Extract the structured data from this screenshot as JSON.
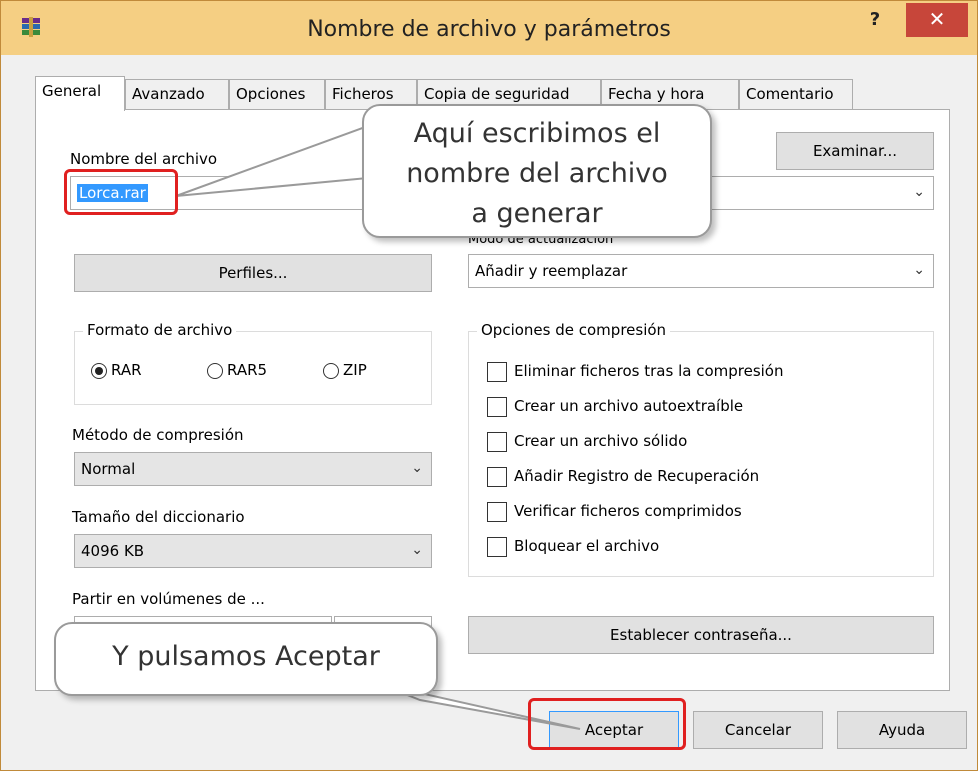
{
  "window": {
    "title": "Nombre de archivo y parámetros",
    "help": "?",
    "close": "✕"
  },
  "tabs": [
    "General",
    "Avanzado",
    "Opciones",
    "Ficheros",
    "Copia de seguridad",
    "Fecha y hora",
    "Comentario"
  ],
  "general": {
    "filename_label": "Nombre del archivo",
    "filename_value": "Lorca.rar",
    "browse_button": "Examinar...",
    "update_mode_label": "Modo de actualización",
    "update_mode_value": "Añadir y reemplazar",
    "profiles_button": "Perfiles...",
    "format_group": "Formato de archivo",
    "format_options": [
      "RAR",
      "RAR5",
      "ZIP"
    ],
    "format_selected": "RAR",
    "method_label": "Método de compresión",
    "method_value": "Normal",
    "dict_label": "Tamaño del diccionario",
    "dict_value": "4096 KB",
    "split_label": "Partir en volúmenes de ...",
    "compression_group": "Opciones de compresión",
    "compression_options": [
      "Eliminar ficheros tras la compresión",
      "Crear un archivo autoextraíble",
      "Crear un archivo sólido",
      "Añadir Registro de Recuperación",
      "Verificar ficheros comprimidos",
      "Bloquear el archivo"
    ],
    "password_button": "Establecer contraseña..."
  },
  "footer": {
    "ok": "Aceptar",
    "cancel": "Cancelar",
    "help": "Ayuda"
  },
  "annotations": {
    "callout_filename": [
      "Aquí escribimos el",
      "nombre del archivo",
      "a generar"
    ],
    "callout_accept": "Y pulsamos Aceptar"
  },
  "colors": {
    "titlebar": "#f5cf83",
    "close": "#c7463a",
    "highlight": "#e02020",
    "selection": "#3399ff"
  }
}
